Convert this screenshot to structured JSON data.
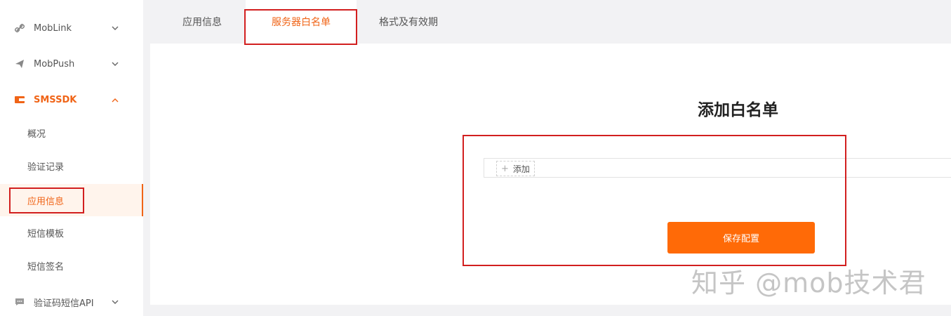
{
  "sidebar": {
    "groups": [
      {
        "label": "MobLink",
        "icon": "link-icon",
        "expanded": false
      },
      {
        "label": "MobPush",
        "icon": "paper-plane-icon",
        "expanded": false
      },
      {
        "label": "SMSSDK",
        "icon": "wallet-icon",
        "expanded": true
      },
      {
        "label": "验证码短信API",
        "icon": "message-icon",
        "expanded": false
      }
    ],
    "sms_items": [
      {
        "label": "概况"
      },
      {
        "label": "验证记录"
      },
      {
        "label": "应用信息",
        "selected": true
      },
      {
        "label": "短信模板"
      },
      {
        "label": "短信签名"
      }
    ]
  },
  "tabs": [
    {
      "label": "应用信息"
    },
    {
      "label": "服务器白名单",
      "active": true
    },
    {
      "label": "格式及有效期"
    }
  ],
  "main": {
    "title": "添加白名单",
    "add_button": {
      "plus": "+",
      "label": "添加"
    },
    "save_button": "保存配置"
  },
  "watermark": "知乎 @mob技术君",
  "colors": {
    "accent": "#f06417",
    "button": "#ff6a07",
    "highlight": "#d21f1f"
  }
}
